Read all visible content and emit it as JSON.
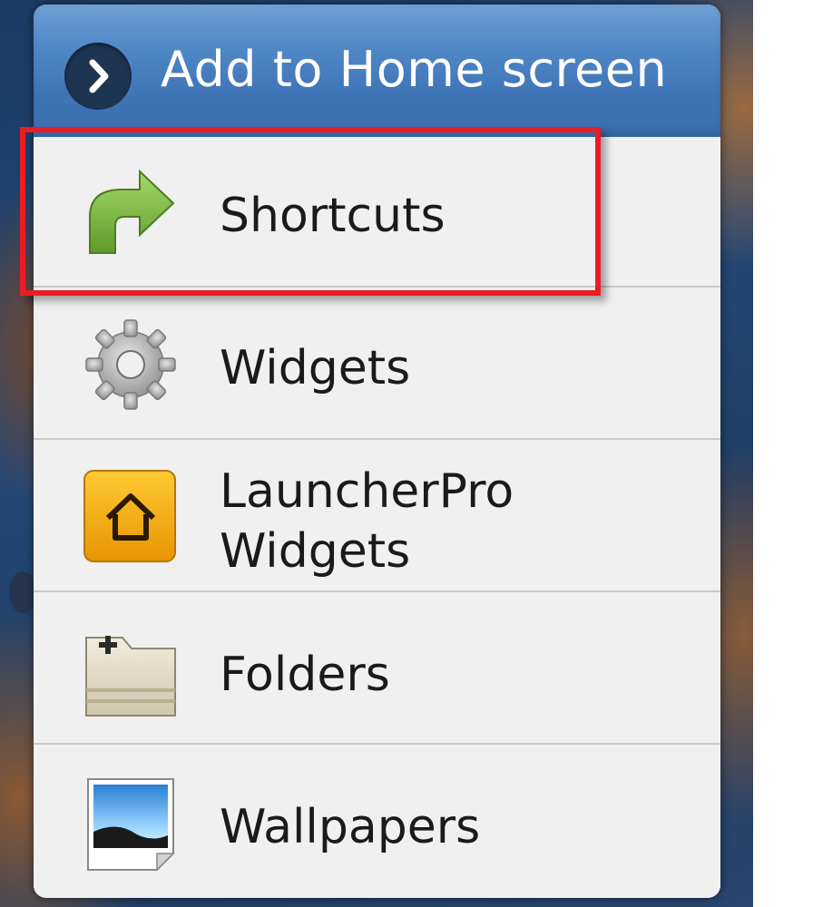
{
  "dialog": {
    "title": "Add to Home screen",
    "header_icon": "chevron-right-icon"
  },
  "menu": {
    "items": [
      {
        "label": "Shortcuts",
        "icon": "shortcut-arrow-icon",
        "highlighted": true
      },
      {
        "label": "Widgets",
        "icon": "gear-icon"
      },
      {
        "label_lines": [
          "LauncherPro",
          "Widgets"
        ],
        "icon": "launcherpro-home-icon"
      },
      {
        "label": "Folders",
        "icon": "folder-add-icon"
      },
      {
        "label": "Wallpapers",
        "icon": "wallpaper-image-icon"
      }
    ]
  },
  "colors": {
    "header_blue": "#3e74b5",
    "highlight_red": "#ea1c24",
    "shortcut_green": "#74b83a",
    "launcherpro_orange": "#f0a500"
  }
}
